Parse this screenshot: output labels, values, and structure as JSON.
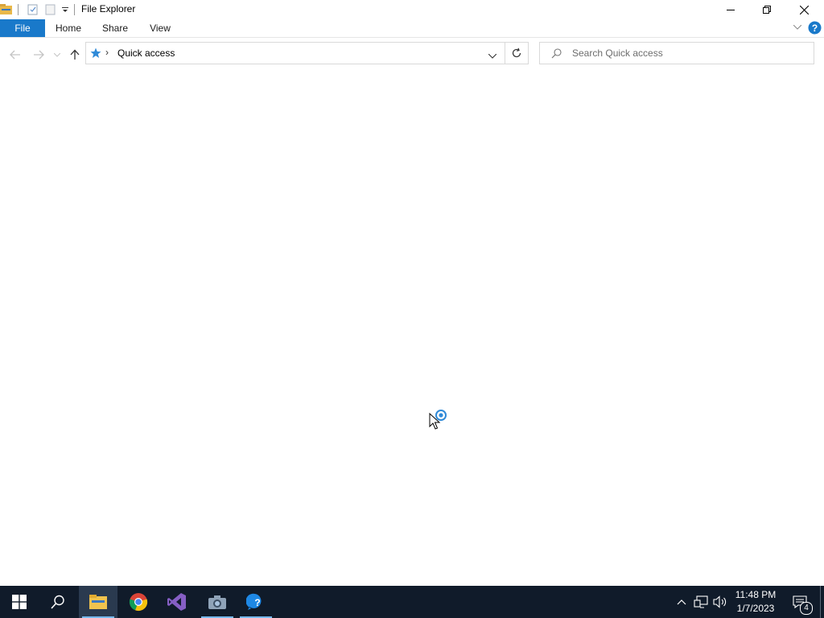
{
  "window": {
    "title": "File Explorer",
    "controls": {
      "minimize": "minimize",
      "restore": "restore",
      "close": "close"
    }
  },
  "ribbon": {
    "tabs": [
      "File",
      "Home",
      "Share",
      "View"
    ]
  },
  "address": {
    "location": "Quick access",
    "separator": "›"
  },
  "search": {
    "placeholder": "Search Quick access"
  },
  "taskbar": {
    "apps": [
      "start-icon",
      "search-icon",
      "file-explorer-icon",
      "chrome-icon",
      "visual-studio-icon",
      "camera-icon",
      "help-icon"
    ],
    "clock": {
      "time": "11:48 PM",
      "date": "1/7/2023"
    },
    "notifications_count": "4"
  },
  "colors": {
    "accent": "#1979ca",
    "taskbar": "#101b2a",
    "help": "#1979ca"
  }
}
